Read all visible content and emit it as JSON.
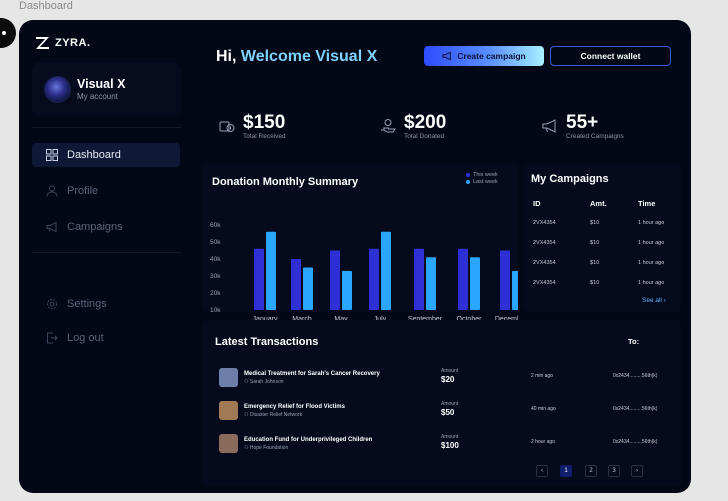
{
  "frame_label": "Dashboard",
  "brand": {
    "name": "ZYRA."
  },
  "profile": {
    "name": "Visual X",
    "subtitle": "My account"
  },
  "nav": {
    "dashboard": "Dashboard",
    "profile": "Profile",
    "campaigns": "Campaigns",
    "settings": "Settings",
    "logout": "Log out"
  },
  "header": {
    "greeting_prefix": "Hi, ",
    "greeting_name": "Welcome Visual X",
    "create_label": "Create campaign",
    "wallet_label": "Connect wallet"
  },
  "stats": [
    {
      "value": "$150",
      "label": "Total Received",
      "icon": "wallet-coin-icon"
    },
    {
      "value": "$200",
      "label": "Total Donated",
      "icon": "donate-hand-icon"
    },
    {
      "value": "55+",
      "label": "Created Campaigns",
      "icon": "megaphone-icon"
    }
  ],
  "chart_data": {
    "type": "bar",
    "title": "Donation Monthly Summary",
    "categories": [
      "January",
      "March",
      "May",
      "July",
      "September",
      "October",
      "December"
    ],
    "series": [
      {
        "name": "This week",
        "color": "#2f2fd6",
        "values": [
          46,
          40,
          45,
          46,
          46,
          46,
          45
        ]
      },
      {
        "name": "Last week",
        "color": "#2aa6ff",
        "values": [
          56,
          35,
          33,
          56,
          41,
          41,
          33
        ]
      }
    ],
    "yticks": [
      "60k",
      "50k",
      "40k",
      "30k",
      "20k",
      "10k"
    ],
    "ylim": [
      10,
      60
    ]
  },
  "campaigns": {
    "title": "My Campaigns",
    "headers": {
      "id": "ID",
      "amt": "Amt.",
      "time": "Time"
    },
    "rows": [
      {
        "id": "2VX4354",
        "amt": "$10",
        "time": "1 hour ago"
      },
      {
        "id": "2VX4354",
        "amt": "$10",
        "time": "1 hour ago"
      },
      {
        "id": "2VX4354",
        "amt": "$10",
        "time": "1 hour ago"
      },
      {
        "id": "2VX4354",
        "amt": "$10",
        "time": "1 hour ago"
      }
    ],
    "see_all": "See all ›"
  },
  "transactions": {
    "title": "Latest Transactions",
    "to_label": "To:",
    "rows": [
      {
        "title": "Medical Treatment for Sarah's Cancer Recovery",
        "org": "Sarah Johnson",
        "amount_label": "Amount",
        "amount": "$20",
        "time": "2 min ago",
        "address": "0x2434.........56th(k)",
        "thumb": "#6d7fa8"
      },
      {
        "title": "Emergency Relief for Flood Victims",
        "org": "Disaster Relief Network",
        "amount_label": "Amount",
        "amount": "$50",
        "time": "40 min ago",
        "address": "0x2434.........56th(k)",
        "thumb": "#a07a55"
      },
      {
        "title": "Education Fund for Underprivileged Children",
        "org": "Hope Foundation",
        "amount_label": "Amount",
        "amount": "$100",
        "time": "2 hour ago",
        "address": "0x2434.........56th(k)",
        "thumb": "#8a6a5a"
      }
    ]
  },
  "pagination": {
    "prev": "‹",
    "pages": [
      "1",
      "2",
      "3"
    ],
    "next": "›"
  },
  "colors": {
    "accent": "#7fd1ff",
    "bg": "#030816",
    "panel": "#050b1c"
  }
}
